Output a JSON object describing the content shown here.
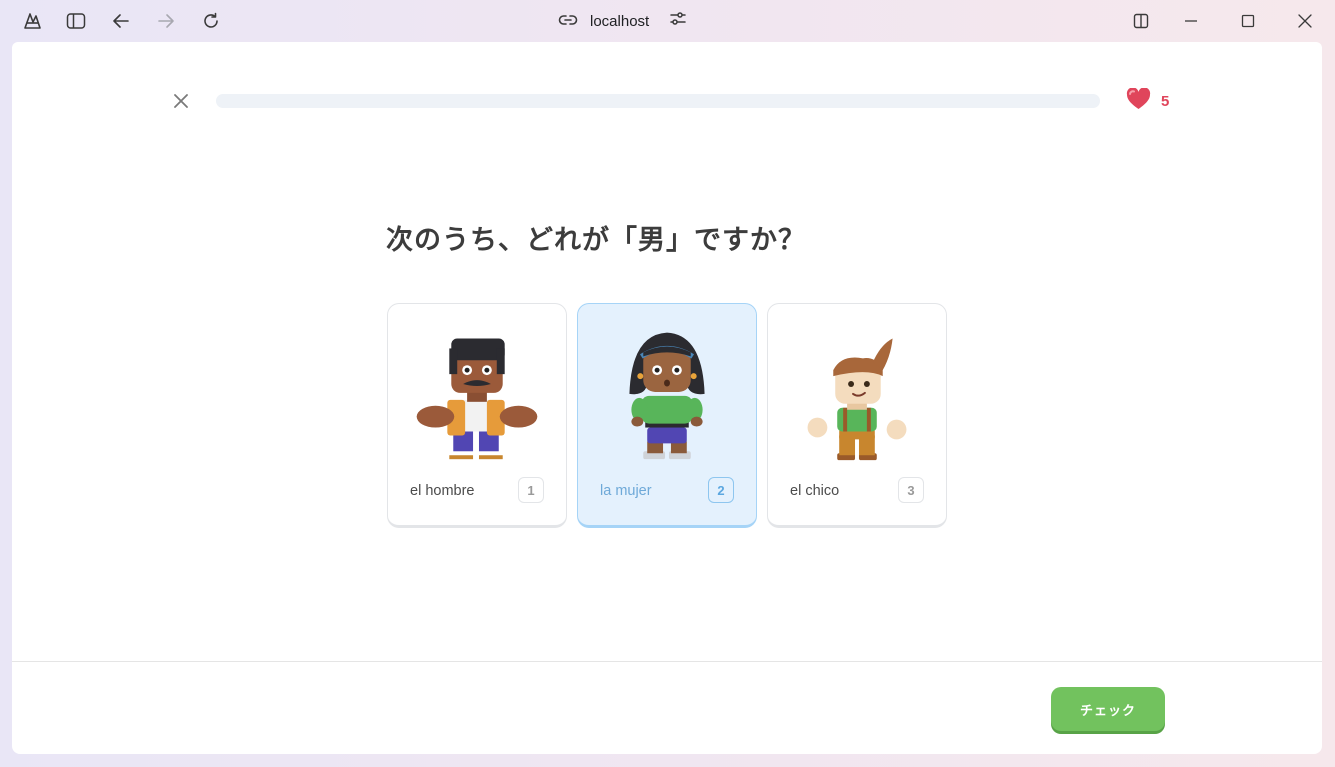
{
  "browser": {
    "url": "localhost"
  },
  "lesson": {
    "progress_fraction": 0.0,
    "hearts": "5",
    "question": "次のうち、どれが「男」ですか？",
    "options": [
      {
        "label": "el hombre",
        "key": "1",
        "selected": false
      },
      {
        "label": "la mujer",
        "key": "2",
        "selected": true
      },
      {
        "label": "el chico",
        "key": "3",
        "selected": false
      }
    ],
    "check_label": "チェック"
  },
  "colors": {
    "accent_green": "#72c25e",
    "selected_blue": "#e4f1fd",
    "heart_red": "#e0455b"
  }
}
